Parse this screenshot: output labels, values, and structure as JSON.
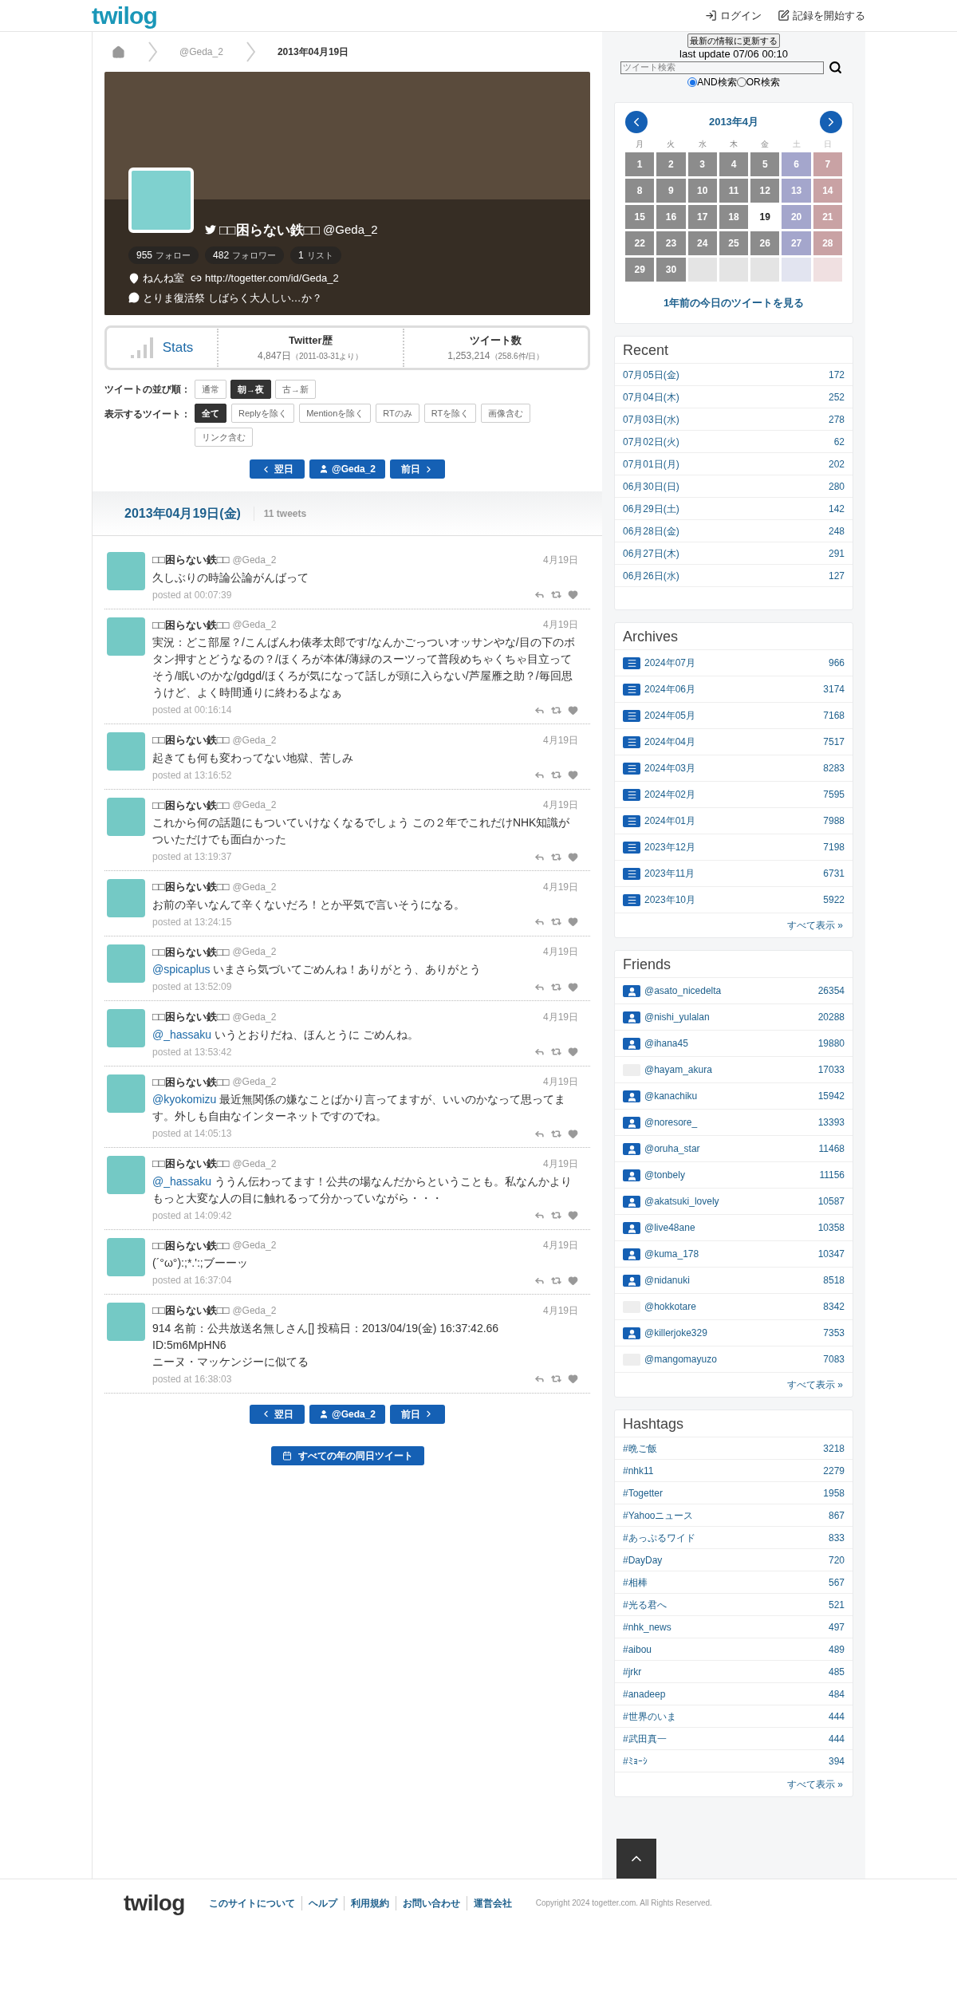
{
  "header": {
    "logo": "twilog",
    "login": "ログイン",
    "start": "記録を開始する"
  },
  "breadcrumb": {
    "user": "@Geda_2",
    "current": "2013年04月19日"
  },
  "profile": {
    "name": "□□困らない鉄□□",
    "handle": "@Geda_2",
    "counts": [
      {
        "number": "955",
        "label": "フォロー"
      },
      {
        "number": "482",
        "label": "フォロワー"
      },
      {
        "number": "1",
        "label": "リスト"
      }
    ],
    "location": "ねんね室",
    "url": "http://togetter.com/id/Geda_2",
    "bio": "とりま復活祭 しばらく大人しい…か？"
  },
  "stats": {
    "title": "Stats",
    "items": [
      {
        "label": "Twitter歴",
        "value": "4,847日",
        "note": "（2011-03-31より）"
      },
      {
        "label": "ツイート数",
        "value": "1,253,214",
        "note": "（258.6件/日）"
      }
    ]
  },
  "sort": {
    "label": "ツイートの並び順：",
    "options": [
      {
        "label": "通常",
        "selected": false
      },
      {
        "label": "朝→夜",
        "selected": true
      },
      {
        "label": "古→新",
        "selected": false
      }
    ]
  },
  "filter": {
    "label": "表示するツイート：",
    "options": [
      {
        "label": "全て",
        "selected": true
      },
      {
        "label": "Replyを除く",
        "selected": false
      },
      {
        "label": "Mentionを除く",
        "selected": false
      },
      {
        "label": "RTのみ",
        "selected": false
      },
      {
        "label": "RTを除く",
        "selected": false
      },
      {
        "label": "画像含む",
        "selected": false
      },
      {
        "label": "リンク含む",
        "selected": false
      }
    ]
  },
  "nav": {
    "next": "翌日",
    "user": "@Geda_2",
    "prev": "前日"
  },
  "day": {
    "title": "2013年04月19日(金)",
    "count": "11 tweets"
  },
  "tweets": [
    {
      "name": "□□困らない鉄□□",
      "handle": "@Geda_2",
      "date": "4月19日",
      "text": "久しぶりの時論公論がんばって",
      "posted": "posted at 00:07:39"
    },
    {
      "name": "□□困らない鉄□□",
      "handle": "@Geda_2",
      "date": "4月19日",
      "text": "実況：どこ部屋？/こんばんわ俵孝太郎です/なんかごっついオッサンやな/目の下のボタン押すとどうなるの？/ほくろが本体/薄緑のスーツって普段めちゃくちゃ目立ってそう/眠いのかな/gdgd/ほくろが気になって話しが頭に入らない/芦屋雁之助？/毎回思うけど、よく時間通りに終わるよなぁ",
      "posted": "posted at 00:16:14"
    },
    {
      "name": "□□困らない鉄□□",
      "handle": "@Geda_2",
      "date": "4月19日",
      "text": "起きても何も変わってない地獄、苦しみ",
      "posted": "posted at 13:16:52"
    },
    {
      "name": "□□困らない鉄□□",
      "handle": "@Geda_2",
      "date": "4月19日",
      "text": "これから何の話題にもついていけなくなるでしょう この２年でこれだけNHK知識がついただけでも面白かった",
      "posted": "posted at 13:19:37"
    },
    {
      "name": "□□困らない鉄□□",
      "handle": "@Geda_2",
      "date": "4月19日",
      "text": "お前の辛いなんて辛くないだろ！とか平気で言いそうになる。",
      "posted": "posted at 13:24:15"
    },
    {
      "name": "□□困らない鉄□□",
      "handle": "@Geda_2",
      "date": "4月19日",
      "mention": "@spicaplus",
      "text": "いまさら気づいてごめんね！ありがとう、ありがとう",
      "posted": "posted at 13:52:09"
    },
    {
      "name": "□□困らない鉄□□",
      "handle": "@Geda_2",
      "date": "4月19日",
      "mention": "@_hassaku",
      "text": "いうとおりだね、ほんとうに ごめんね。",
      "posted": "posted at 13:53:42"
    },
    {
      "name": "□□困らない鉄□□",
      "handle": "@Geda_2",
      "date": "4月19日",
      "mention": "@kyokomizu",
      "text": "最近無関係の嫌なことばかり言ってますが、いいのかなって思ってます。外しも自由なインターネットですのでね。",
      "posted": "posted at 14:05:13"
    },
    {
      "name": "□□困らない鉄□□",
      "handle": "@Geda_2",
      "date": "4月19日",
      "mention": "@_hassaku",
      "text": "ううん伝わってます！公共の場なんだからということも。私なんかよりもっと大変な人の目に触れるって分かっていながら・・・",
      "posted": "posted at 14:09:42"
    },
    {
      "name": "□□困らない鉄□□",
      "handle": "@Geda_2",
      "date": "4月19日",
      "text": "(´°ω°):;*.':;ブーーッ",
      "posted": "posted at 16:37:04"
    },
    {
      "name": "□□困らない鉄□□",
      "handle": "@Geda_2",
      "date": "4月19日",
      "text": "914 名前：公共放送名無しさん[] 投稿日：2013/04/19(金) 16:37:42.66\nID:5m6MpHN6\nニーヌ・マッケンジーに似てる",
      "posted": "posted at 16:38:03"
    }
  ],
  "bottom_nav": {
    "next": "翌日",
    "user": "@Geda_2",
    "prev": "前日",
    "all_years": "すべての年の同日ツイート"
  },
  "search": {
    "refresh": "最新の情報に更新する",
    "last_update": "last update 07/06 00:10",
    "placeholder": "ツイート検索",
    "modes": [
      {
        "label": "AND検索",
        "selected": true
      },
      {
        "label": "OR検索",
        "selected": false
      }
    ]
  },
  "calendar": {
    "title": "2013年4月",
    "weekdays": [
      "月",
      "火",
      "水",
      "木",
      "金",
      "土",
      "日"
    ],
    "cells": [
      {
        "day": "1",
        "kind": "weekday",
        "selected": false
      },
      {
        "day": "2",
        "kind": "weekday",
        "selected": false
      },
      {
        "day": "3",
        "kind": "weekday",
        "selected": false
      },
      {
        "day": "4",
        "kind": "weekday",
        "selected": false
      },
      {
        "day": "5",
        "kind": "weekday",
        "selected": false
      },
      {
        "day": "6",
        "kind": "saturday",
        "selected": false
      },
      {
        "day": "7",
        "kind": "sunday",
        "selected": false
      },
      {
        "day": "8",
        "kind": "weekday",
        "selected": false
      },
      {
        "day": "9",
        "kind": "weekday",
        "selected": false
      },
      {
        "day": "10",
        "kind": "weekday",
        "selected": false
      },
      {
        "day": "11",
        "kind": "weekday",
        "selected": false
      },
      {
        "day": "12",
        "kind": "weekday",
        "selected": false
      },
      {
        "day": "13",
        "kind": "saturday",
        "selected": false
      },
      {
        "day": "14",
        "kind": "sunday",
        "selected": false
      },
      {
        "day": "15",
        "kind": "weekday",
        "selected": false
      },
      {
        "day": "16",
        "kind": "weekday",
        "selected": false
      },
      {
        "day": "17",
        "kind": "weekday",
        "selected": false
      },
      {
        "day": "18",
        "kind": "weekday",
        "selected": false
      },
      {
        "day": "19",
        "kind": "weekday",
        "selected": true
      },
      {
        "day": "20",
        "kind": "saturday",
        "selected": false
      },
      {
        "day": "21",
        "kind": "sunday",
        "selected": false
      },
      {
        "day": "22",
        "kind": "weekday",
        "selected": false
      },
      {
        "day": "23",
        "kind": "weekday",
        "selected": false
      },
      {
        "day": "24",
        "kind": "weekday",
        "selected": false
      },
      {
        "day": "25",
        "kind": "weekday",
        "selected": false
      },
      {
        "day": "26",
        "kind": "weekday",
        "selected": false
      },
      {
        "day": "27",
        "kind": "saturday",
        "selected": false
      },
      {
        "day": "28",
        "kind": "sunday",
        "selected": false
      },
      {
        "day": "29",
        "kind": "weekday",
        "selected": false
      },
      {
        "day": "30",
        "kind": "weekday",
        "selected": false
      },
      {
        "kind": "empty-weekday",
        "selected": false
      },
      {
        "kind": "empty-weekday",
        "selected": false
      },
      {
        "kind": "empty-weekday",
        "selected": false
      },
      {
        "kind": "empty-saturday",
        "selected": false
      },
      {
        "kind": "empty-sunday",
        "selected": false
      }
    ],
    "link": "1年前の今日のツイートを見る"
  },
  "recent": {
    "title": "Recent",
    "rows": [
      {
        "date": "07月05日(金)",
        "count": "172"
      },
      {
        "date": "07月04日(木)",
        "count": "252"
      },
      {
        "date": "07月03日(水)",
        "count": "278"
      },
      {
        "date": "07月02日(火)",
        "count": "62"
      },
      {
        "date": "07月01日(月)",
        "count": "202"
      },
      {
        "date": "06月30日(日)",
        "count": "280"
      },
      {
        "date": "06月29日(土)",
        "count": "142"
      },
      {
        "date": "06月28日(金)",
        "count": "248"
      },
      {
        "date": "06月27日(木)",
        "count": "291"
      },
      {
        "date": "06月26日(水)",
        "count": "127"
      }
    ]
  },
  "archives": {
    "title": "Archives",
    "rows": [
      {
        "month": "2024年07月",
        "count": "966"
      },
      {
        "month": "2024年06月",
        "count": "3174"
      },
      {
        "month": "2024年05月",
        "count": "7168"
      },
      {
        "month": "2024年04月",
        "count": "7517"
      },
      {
        "month": "2024年03月",
        "count": "8283"
      },
      {
        "month": "2024年02月",
        "count": "7595"
      },
      {
        "month": "2024年01月",
        "count": "7988"
      },
      {
        "month": "2023年12月",
        "count": "7198"
      },
      {
        "month": "2023年11月",
        "count": "6731"
      },
      {
        "month": "2023年10月",
        "count": "5922"
      }
    ],
    "more": "すべて表示 »"
  },
  "friends": {
    "title": "Friends",
    "rows": [
      {
        "name": "@asato_nicedelta",
        "count": "26354",
        "avatar": true
      },
      {
        "name": "@nishi_yulalan",
        "count": "20288",
        "avatar": true
      },
      {
        "name": "@ihana45",
        "count": "19880",
        "avatar": true
      },
      {
        "name": "@hayam_akura",
        "count": "17033",
        "avatar": false
      },
      {
        "name": "@kanachiku",
        "count": "15942",
        "avatar": true
      },
      {
        "name": "@noresore_",
        "count": "13393",
        "avatar": true
      },
      {
        "name": "@oruha_star",
        "count": "11468",
        "avatar": true
      },
      {
        "name": "@tonbely",
        "count": "11156",
        "avatar": true
      },
      {
        "name": "@akatsuki_lovely",
        "count": "10587",
        "avatar": true
      },
      {
        "name": "@live48ane",
        "count": "10358",
        "avatar": true
      },
      {
        "name": "@kuma_178",
        "count": "10347",
        "avatar": true
      },
      {
        "name": "@nidanuki",
        "count": "8518",
        "avatar": true
      },
      {
        "name": "@hokkotare",
        "count": "8342",
        "avatar": false
      },
      {
        "name": "@killerjoke329",
        "count": "7353",
        "avatar": true
      },
      {
        "name": "@mangomayuzo",
        "count": "7083",
        "avatar": false
      }
    ],
    "more": "すべて表示 »"
  },
  "hashtags": {
    "title": "Hashtags",
    "rows": [
      {
        "tag": "#晩ご飯",
        "count": "3218"
      },
      {
        "tag": "#nhk11",
        "count": "2279"
      },
      {
        "tag": "#Togetter",
        "count": "1958"
      },
      {
        "tag": "#Yahooニュース",
        "count": "867"
      },
      {
        "tag": "#あっぷるワイド",
        "count": "833"
      },
      {
        "tag": "#DayDay",
        "count": "720"
      },
      {
        "tag": "#相棒",
        "count": "567"
      },
      {
        "tag": "#光る君へ",
        "count": "521"
      },
      {
        "tag": "#nhk_news",
        "count": "497"
      },
      {
        "tag": "#aibou",
        "count": "489"
      },
      {
        "tag": "#jrkr",
        "count": "485"
      },
      {
        "tag": "#anadeep",
        "count": "484"
      },
      {
        "tag": "#世界のいま",
        "count": "444"
      },
      {
        "tag": "#武田真一",
        "count": "444"
      },
      {
        "tag": "#ﾐｮｰｼ",
        "count": "394"
      }
    ],
    "more": "すべて表示 »"
  },
  "footer": {
    "logo": "twilog",
    "links": [
      "このサイトについて",
      "ヘルプ",
      "利用規約",
      "お問い合わせ",
      "運営会社"
    ],
    "copyright": "Copyright 2024 togetter.com. All Rights Reserved."
  }
}
